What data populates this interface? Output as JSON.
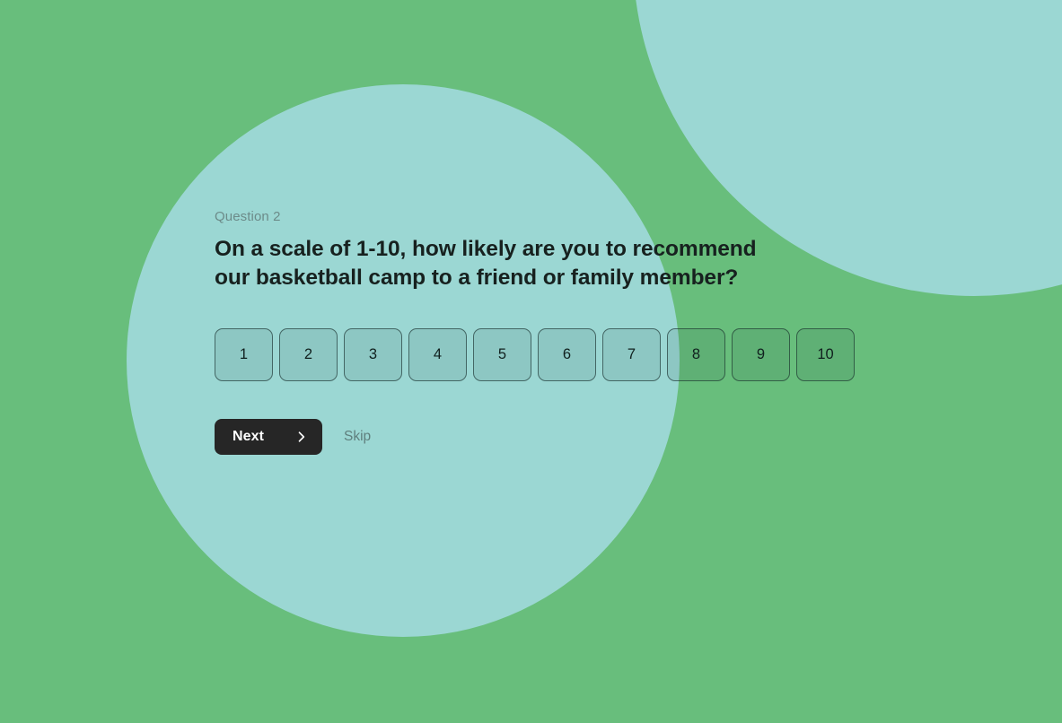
{
  "theme": {
    "background_green": "#68be7c",
    "accent_teal": "#9bd7d3",
    "button_dark": "#262626",
    "question_text_color": "#17211f",
    "muted_text_color": "#6c8b89"
  },
  "question": {
    "number_label": "Question 2",
    "text": "On a scale of 1-10, how likely are you to recommend our basketball camp to a friend or family member?"
  },
  "scale": {
    "min": 1,
    "max": 10,
    "options": [
      "1",
      "2",
      "3",
      "4",
      "5",
      "6",
      "7",
      "8",
      "9",
      "10"
    ]
  },
  "actions": {
    "next_label": "Next",
    "next_icon": "chevron-right-icon",
    "skip_label": "Skip"
  }
}
